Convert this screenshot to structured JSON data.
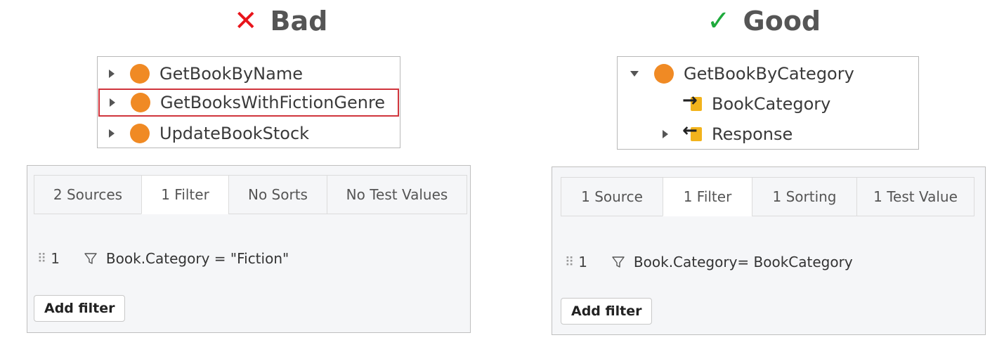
{
  "bad": {
    "heading": "Bad",
    "tree": [
      "GetBookByName",
      "GetBooksWithFictionGenre",
      "UpdateBookStock"
    ],
    "tabs": [
      "2 Sources",
      "1 Filter",
      "No Sorts",
      "No Test Values"
    ],
    "filter_index": "1",
    "filter_expr": "Book.Category = \"Fiction\"",
    "add_filter": "Add filter"
  },
  "good": {
    "heading": "Good",
    "tree": [
      "GetBookByCategory",
      "BookCategory",
      "Response"
    ],
    "tabs": [
      "1 Source",
      "1 Filter",
      "1 Sorting",
      "1 Test Value"
    ],
    "filter_index": "1",
    "filter_expr": "Book.Category= BookCategory",
    "add_filter": "Add filter"
  },
  "colors": {
    "bad": "#e8141b",
    "good": "#1faa3c",
    "action": "#f08a24",
    "param": "#f2b31c",
    "highlight": "#d0343c"
  },
  "icons": [
    "cross-icon",
    "check-icon",
    "action-dot-icon",
    "input-param-icon",
    "output-param-icon",
    "funnel-icon",
    "drag-handle-icon"
  ]
}
